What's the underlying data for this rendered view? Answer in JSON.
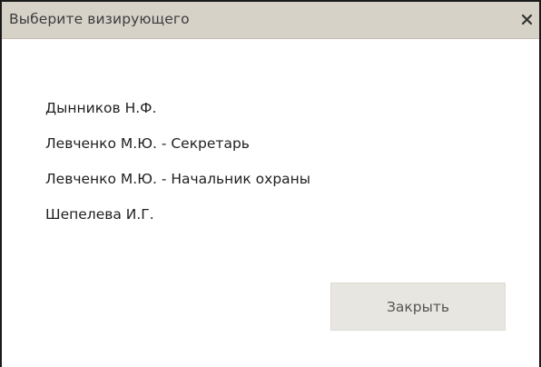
{
  "dialog": {
    "title": "Выберите визирующего",
    "close_icon": "close-icon"
  },
  "items": [
    "Дынников Н.Ф.",
    "Левченко М.Ю. - Секретарь",
    "Левченко М.Ю. - Начальник охраны",
    "Шепелева И.Г."
  ],
  "footer": {
    "close_label": "Закрыть"
  },
  "colors": {
    "titlebar": "#d6d2c8",
    "button": "#e8e6e1"
  }
}
